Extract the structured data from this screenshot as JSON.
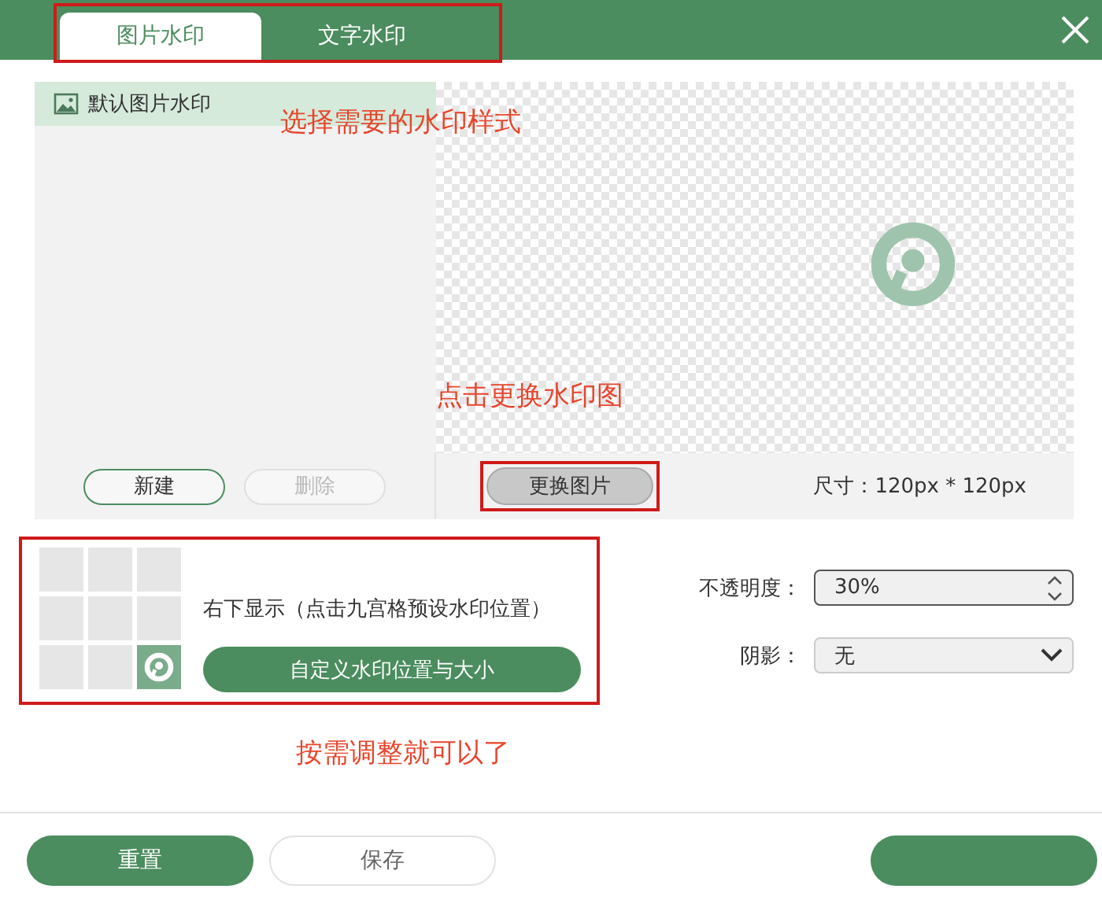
{
  "tabs": [
    {
      "label": "图片水印",
      "selected": true
    },
    {
      "label": "文字水印",
      "selected": false
    }
  ],
  "watermark_list": {
    "items": [
      {
        "label": "默认图片水印",
        "selected": true
      }
    ],
    "buttons": [
      {
        "label": "新建",
        "disabled": false
      },
      {
        "label": "删除",
        "disabled": true
      }
    ]
  },
  "preview": {
    "button": "更换图片",
    "size": "尺寸：120px * 120px"
  },
  "position": {
    "cells": [
      {
        "selected": false
      },
      {
        "selected": false
      },
      {
        "selected": false
      },
      {
        "selected": false
      },
      {
        "selected": false
      },
      {
        "selected": false
      },
      {
        "selected": false
      },
      {
        "selected": false
      },
      {
        "selected": true
      }
    ],
    "caption": "右下显示（点击九宫格预设水印位置）",
    "button": "自定义水印位置与大小"
  },
  "opacity": {
    "label": "不透明度：",
    "value": "30%"
  },
  "shadow": {
    "label": "阴影：",
    "value": "无"
  },
  "footer": {
    "buttons": [
      {
        "label": "重置",
        "kind": "primary"
      },
      {
        "label": "保存",
        "kind": "secondary"
      },
      {
        "kind": "primary"
      }
    ]
  },
  "annotations": [
    "选择需要的水印样式",
    "点击更换水印图",
    "按需调整就可以了"
  ]
}
